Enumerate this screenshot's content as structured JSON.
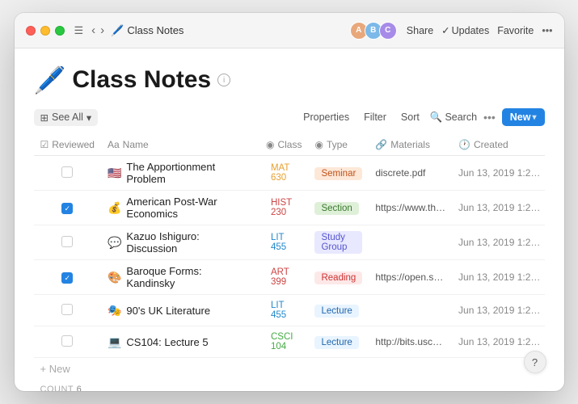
{
  "titlebar": {
    "title": "Class Notes",
    "breadcrumb_emoji": "🖊️",
    "share_label": "Share",
    "updates_label": "Updates",
    "favorite_label": "Favorite",
    "more_icon": "•••"
  },
  "page": {
    "title_emoji": "🖊️",
    "title": "Class Notes",
    "info_icon_label": "i"
  },
  "toolbar": {
    "see_all_label": "See All",
    "properties_label": "Properties",
    "filter_label": "Filter",
    "sort_label": "Sort",
    "search_label": "Search",
    "new_label": "New"
  },
  "table": {
    "columns": [
      {
        "id": "reviewed",
        "label": "Reviewed",
        "icon": "checkbox-icon"
      },
      {
        "id": "name",
        "label": "Name",
        "icon": "text-icon"
      },
      {
        "id": "class",
        "label": "Class",
        "icon": "tag-icon"
      },
      {
        "id": "type",
        "label": "Type",
        "icon": "tag-icon"
      },
      {
        "id": "materials",
        "label": "Materials",
        "icon": "link-icon"
      },
      {
        "id": "created",
        "label": "Created",
        "icon": "clock-icon"
      }
    ],
    "rows": [
      {
        "checked": false,
        "name_emoji": "🇺🇸",
        "name": "The Apportionment Problem",
        "class": "MAT 630",
        "class_color": "mat630",
        "type": "Seminar",
        "type_badge": "badge-seminar",
        "materials": "discrete.pdf",
        "created": "Jun 13, 2019 1:2…"
      },
      {
        "checked": true,
        "name_emoji": "💰",
        "name": "American Post-War Economics",
        "class": "HIST 230",
        "class_color": "hist230",
        "type": "Section",
        "type_badge": "badge-section",
        "materials": "https://www.th…",
        "created": "Jun 13, 2019 1:2…"
      },
      {
        "checked": false,
        "name_emoji": "💬",
        "name": "Kazuo Ishiguro: Discussion",
        "class": "LIT 455",
        "class_color": "lit455",
        "type": "Study Group",
        "type_badge": "badge-study-group",
        "materials": "",
        "created": "Jun 13, 2019 1:2…"
      },
      {
        "checked": true,
        "name_emoji": "🎨",
        "name": "Baroque Forms: Kandinsky",
        "class": "ART 399",
        "class_color": "art399",
        "type": "Reading",
        "type_badge": "badge-reading",
        "materials": "https://open.s…",
        "created": "Jun 13, 2019 1:2…"
      },
      {
        "checked": false,
        "name_emoji": "🎭",
        "name": "90's UK Literature",
        "class": "LIT 455",
        "class_color": "lit455",
        "type": "Lecture",
        "type_badge": "badge-lecture",
        "materials": "",
        "created": "Jun 13, 2019 1:2…"
      },
      {
        "checked": false,
        "name_emoji": "💻",
        "name": "CS104: Lecture 5",
        "class": "CSCI 104",
        "class_color": "csci104",
        "type": "Lecture",
        "type_badge": "badge-lecture",
        "materials": "http://bits.usc…",
        "created": "Jun 13, 2019 1:2…"
      }
    ],
    "add_new_label": "+ New",
    "count_label": "COUNT",
    "count_value": "6"
  },
  "help": {
    "label": "?"
  }
}
